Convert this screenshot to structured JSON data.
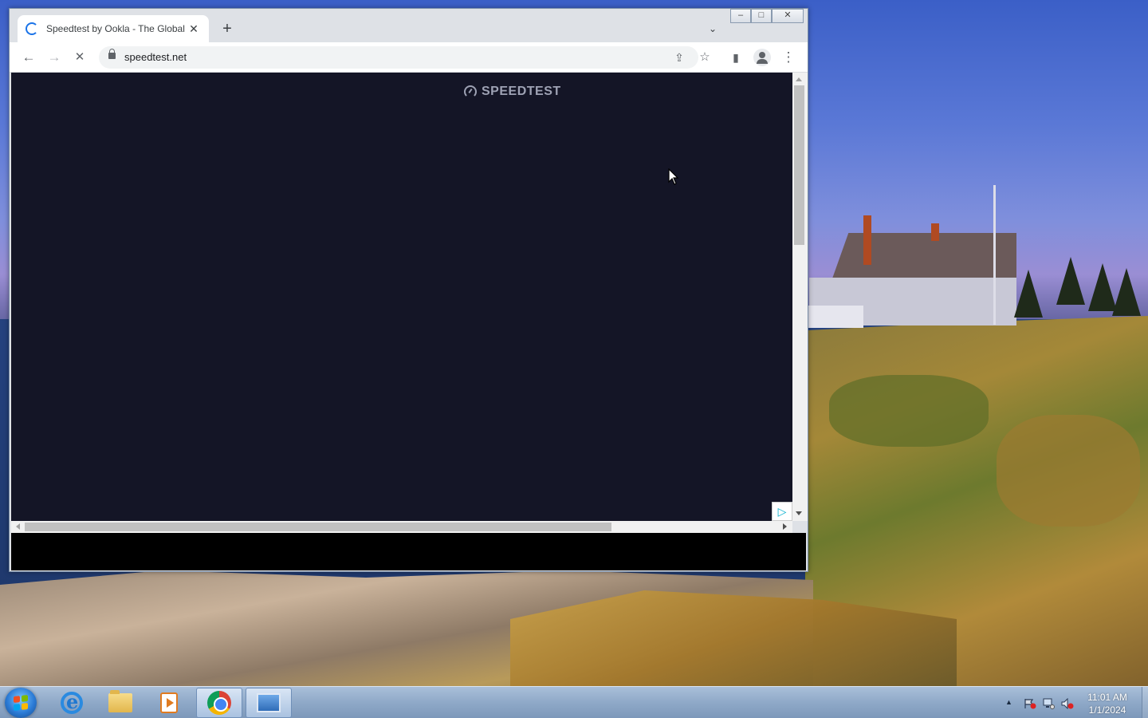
{
  "browser": {
    "tab_title": "Speedtest by Ookla - The Global",
    "tab_close": "✕",
    "new_tab": "+",
    "tab_search": "⌄",
    "window_controls": {
      "minimize": "–",
      "maximize": "□",
      "close": "✕"
    },
    "nav": {
      "back": "←",
      "forward": "→",
      "stop": "✕"
    },
    "url": "speedtest.net",
    "omnibox_icons": {
      "share": "⇪",
      "bookmark": "☆"
    },
    "side_panel": "▮",
    "menu": "⋮"
  },
  "page": {
    "logo_text": "SPEEDTEST",
    "ad_badge": "▷"
  },
  "taskbar": {
    "apps": [
      "internet-explorer",
      "file-explorer",
      "media-player",
      "chrome",
      "remote-desktop"
    ],
    "tray_arrow": "▲",
    "clock_time": "11:01 AM",
    "clock_date": "1/1/2024"
  },
  "colors": {
    "page_background": "#141526",
    "accent": "#1a73e8"
  }
}
